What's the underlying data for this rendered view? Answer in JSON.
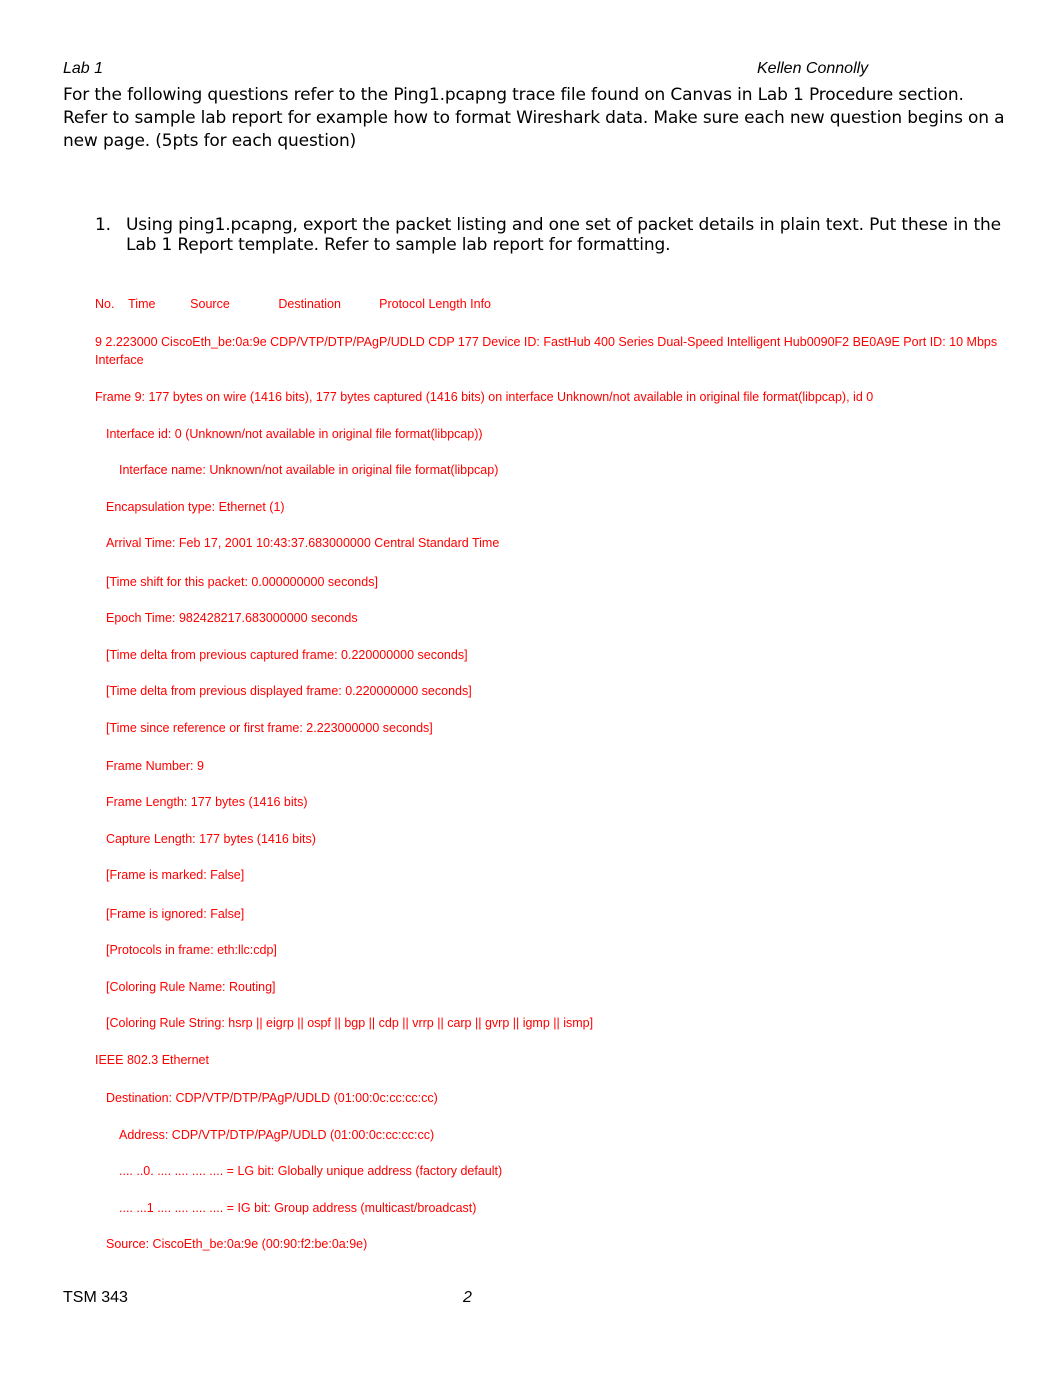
{
  "header": {
    "left": "Lab 1",
    "right": "Kellen Connolly"
  },
  "intro": "For the following questions refer to the Ping1.pcapng trace file found on Canvas in Lab 1 Procedure section. Refer to sample lab report for example how to format Wireshark data. Make sure each new question begins on a new page. (5pts for each question)",
  "question": {
    "number": "1.",
    "text": "Using ping1.pcapng, export the packet listing and one set of packet details in plain text.  Put these in the Lab 1 Report template. Refer to sample lab report for formatting."
  },
  "packet_listing": {
    "header": "No.    Time          Source              Destination           Protocol Length Info",
    "row": "      9 2.223000       CiscoEth_be:0a:9e     CDP/VTP/DTP/PAgP/UDLD CDP      177    Device ID: FastHub 400 Series Dual-Speed Intelligent Hub0090F2 BE0A9E  Port ID: 10 Mbps Interface"
  },
  "packet_details": [
    "Frame 9: 177 bytes on wire (1416 bits), 177 bytes captured (1416 bits) on interface Unknown/not available in original file format(libpcap), id 0",
    "Interface id: 0 (Unknown/not available in original file format(libpcap))",
    "Interface name: Unknown/not available in original file format(libpcap)",
    "Encapsulation type: Ethernet (1)",
    "Arrival Time: Feb 17, 2001 10:43:37.683000000 Central Standard Time",
    "[Time shift for this packet: 0.000000000 seconds]",
    "Epoch Time: 982428217.683000000 seconds",
    "[Time delta from previous captured frame: 0.220000000 seconds]",
    "[Time delta from previous displayed frame: 0.220000000 seconds]",
    "[Time since reference or first frame: 2.223000000 seconds]",
    "Frame Number: 9",
    "Frame Length: 177 bytes (1416 bits)",
    "Capture Length: 177 bytes (1416 bits)",
    "[Frame is marked: False]",
    "[Frame is ignored: False]",
    "[Protocols in frame: eth:llc:cdp]",
    "[Coloring Rule Name: Routing]",
    "[Coloring Rule String: hsrp || eigrp || ospf || bgp || cdp || vrrp || carp || gvrp || igmp || ismp]",
    "IEEE 802.3 Ethernet",
    "Destination: CDP/VTP/DTP/PAgP/UDLD (01:00:0c:cc:cc:cc)",
    "Address: CDP/VTP/DTP/PAgP/UDLD (01:00:0c:cc:cc:cc)",
    ".... ..0. .... .... .... .... = LG bit: Globally unique address (factory default)",
    ".... ...1 .... .... .... .... = IG bit: Group address (multicast/broadcast)",
    "Source: CiscoEth_be:0a:9e (00:90:f2:be:0a:9e)"
  ],
  "footer": {
    "left": "TSM 343",
    "page_number": "2"
  },
  "colors": {
    "wireshark_text": "#ff0000",
    "body_text": "#000000"
  }
}
